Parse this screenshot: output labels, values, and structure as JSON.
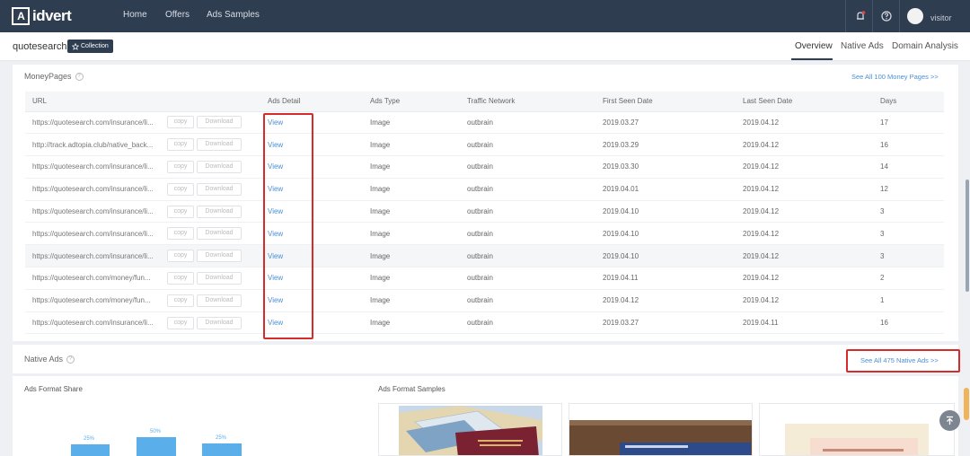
{
  "brand": {
    "logo_mark": "A",
    "logo_text": "idvert"
  },
  "nav": {
    "home": "Home",
    "offers": "Offers",
    "ads_samples": "Ads Samples"
  },
  "user": {
    "name": "visitor"
  },
  "site": {
    "name": "quotesearch",
    "collection_label": "Collection"
  },
  "tabs": {
    "overview": "Overview",
    "native_ads": "Native Ads",
    "domain_analysis": "Domain Analysis"
  },
  "money_pages": {
    "title": "MoneyPages",
    "see_all": "See All 100 Money Pages >>",
    "columns": [
      "URL",
      "Ads Detail",
      "Ads Type",
      "Traffic Network",
      "First Seen Date",
      "Last Seen Date",
      "Days"
    ],
    "copy_label": "copy",
    "download_label": "Download",
    "rows": [
      {
        "url": "https://quotesearch.com/insurance/li...",
        "detail": "View",
        "type": "Image",
        "network": "outbrain",
        "first": "2019.03.27",
        "last": "2019.04.12",
        "days": "17"
      },
      {
        "url": "http://track.adtopia.club/native_back...",
        "detail": "View",
        "type": "Image",
        "network": "outbrain",
        "first": "2019.03.29",
        "last": "2019.04.12",
        "days": "16"
      },
      {
        "url": "https://quotesearch.com/insurance/li...",
        "detail": "View",
        "type": "Image",
        "network": "outbrain",
        "first": "2019.03.30",
        "last": "2019.04.12",
        "days": "14"
      },
      {
        "url": "https://quotesearch.com/insurance/li...",
        "detail": "View",
        "type": "Image",
        "network": "outbrain",
        "first": "2019.04.01",
        "last": "2019.04.12",
        "days": "12"
      },
      {
        "url": "https://quotesearch.com/insurance/li...",
        "detail": "View",
        "type": "Image",
        "network": "outbrain",
        "first": "2019.04.10",
        "last": "2019.04.12",
        "days": "3"
      },
      {
        "url": "https://quotesearch.com/insurance/li...",
        "detail": "View",
        "type": "Image",
        "network": "outbrain",
        "first": "2019.04.10",
        "last": "2019.04.12",
        "days": "3"
      },
      {
        "url": "https://quotesearch.com/insurance/li...",
        "detail": "View",
        "type": "Image",
        "network": "outbrain",
        "first": "2019.04.10",
        "last": "2019.04.12",
        "days": "3"
      },
      {
        "url": "https://quotesearch.com/money/fun...",
        "detail": "View",
        "type": "Image",
        "network": "outbrain",
        "first": "2019.04.11",
        "last": "2019.04.12",
        "days": "2"
      },
      {
        "url": "https://quotesearch.com/money/fun...",
        "detail": "View",
        "type": "Image",
        "network": "outbrain",
        "first": "2019.04.12",
        "last": "2019.04.12",
        "days": "1"
      },
      {
        "url": "https://quotesearch.com/insurance/li...",
        "detail": "View",
        "type": "Image",
        "network": "outbrain",
        "first": "2019.03.27",
        "last": "2019.04.11",
        "days": "16"
      }
    ]
  },
  "native_ads": {
    "title": "Native Ads",
    "see_all": "See All 475 Native Ads >>",
    "format_share_title": "Ads Format Share",
    "format_samples_title": "Ads Format Samples",
    "bars": [
      {
        "label": "25%",
        "value": 25
      },
      {
        "label": "50%",
        "value": 50
      },
      {
        "label": "25%",
        "value": 25
      }
    ]
  },
  "colors": {
    "nav_bg": "#2f3d51",
    "link": "#4b8fd6",
    "highlight": "#d62b2b",
    "bar": "#5aaeea"
  }
}
